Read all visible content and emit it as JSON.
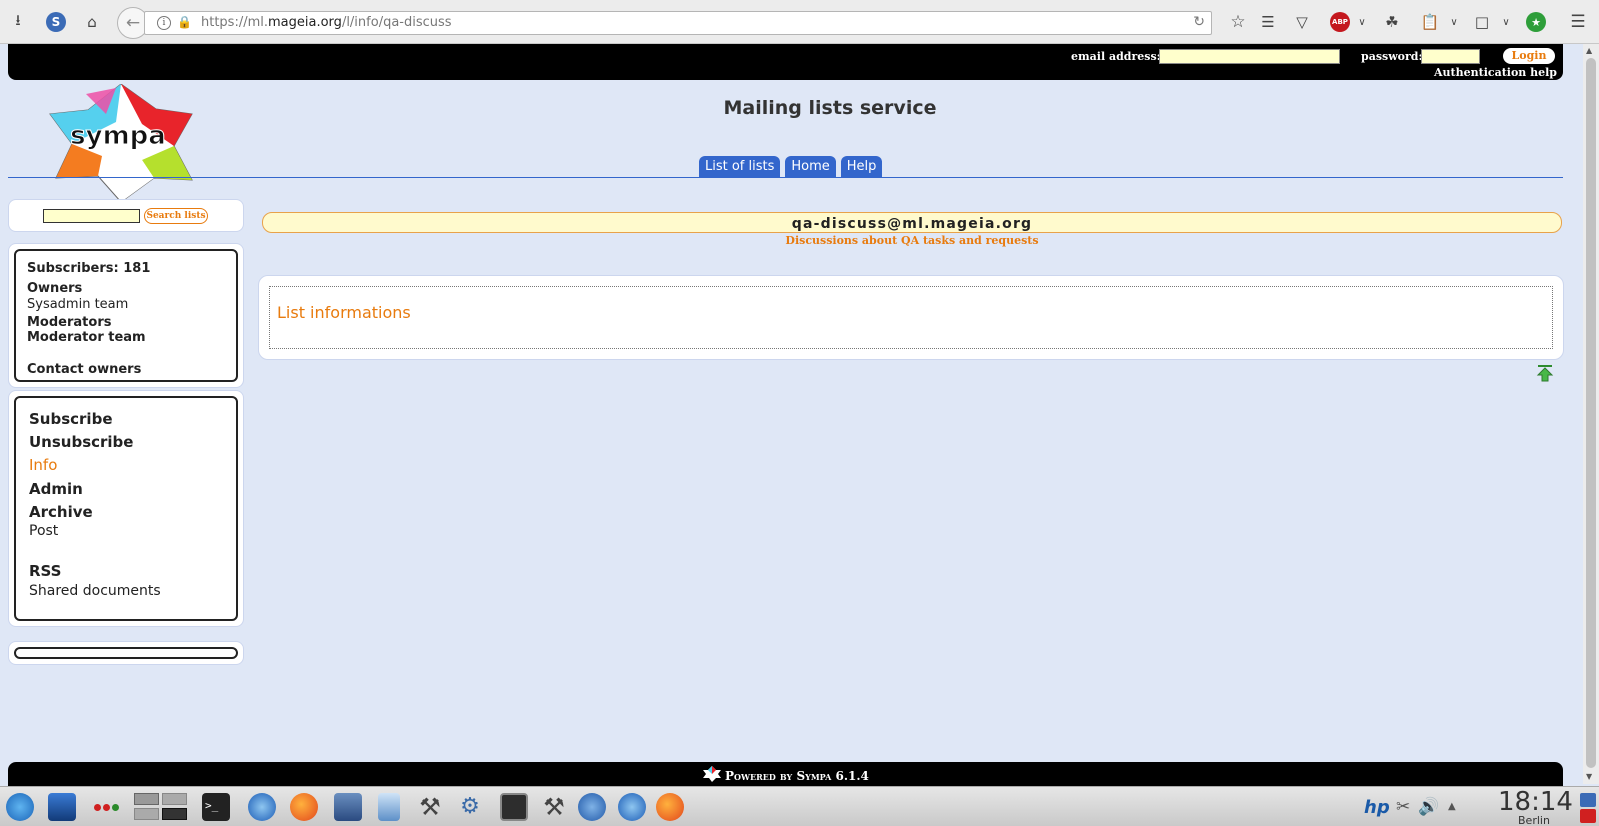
{
  "browser": {
    "url_prefix": "https://ml.",
    "url_domain": "mageia.org",
    "url_path": "/l/info/qa-discuss"
  },
  "header": {
    "email_label": "email address:",
    "password_label": "password:",
    "login_button": "Login",
    "auth_help": "Authentication help",
    "site_title": "Mailing lists service",
    "nav_tabs": [
      "List of lists",
      "Home",
      "Help"
    ],
    "logo_text": "sympa"
  },
  "sidebar": {
    "search_button": "Search lists",
    "subscribers": "Subscribers: 181",
    "owners_label": "Owners",
    "owners_value": "Sysadmin team",
    "moderators_label": "Moderators",
    "moderators_value": "Moderator team",
    "contact_owners": "Contact owners",
    "menu": {
      "subscribe": "Subscribe",
      "unsubscribe": "Unsubscribe",
      "info": "Info",
      "admin": "Admin",
      "archive": "Archive",
      "post": "Post",
      "rss": "RSS",
      "shared_documents": "Shared documents"
    }
  },
  "main": {
    "list_address": "qa-discuss@ml.mageia.org",
    "list_subject": "Discussions about QA tasks and requests",
    "section_heading": "List informations"
  },
  "footer": {
    "powered_by": "Powered by Sympa 6.1.4"
  },
  "taskbar": {
    "clock": "18:14",
    "city": "Berlin"
  },
  "colors": {
    "accent": "#e87b0e",
    "tab_blue": "#3366cc",
    "page_bg": "#dfe7f6",
    "banner_bg": "#fffacd"
  }
}
